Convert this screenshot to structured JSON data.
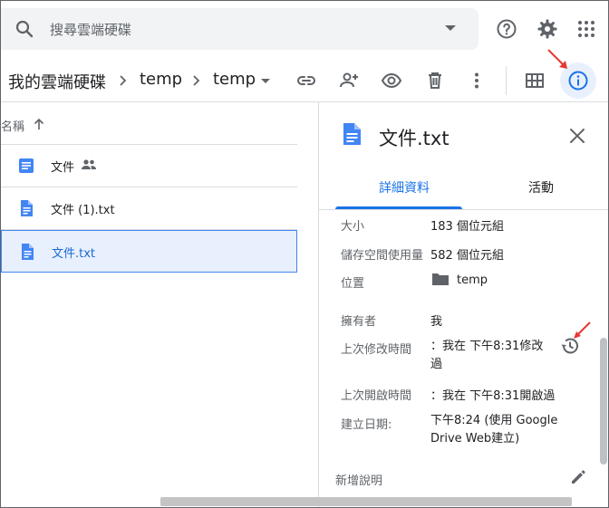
{
  "search": {
    "placeholder": "搜尋雲端硬碟"
  },
  "breadcrumb": {
    "root": "我的雲端硬碟",
    "level1": "temp",
    "level2": "temp"
  },
  "list": {
    "header": "名稱",
    "files": [
      {
        "name": "文件",
        "type": "doc",
        "shared": true
      },
      {
        "name": "文件 (1).txt",
        "type": "file",
        "shared": false
      },
      {
        "name": "文件.txt",
        "type": "file",
        "shared": false,
        "selected": true
      }
    ]
  },
  "panel": {
    "title": "文件.txt",
    "tabs": {
      "details": "詳細資料",
      "activity": "活動"
    },
    "details": {
      "size_label": "大小",
      "size_value": "183 個位元組",
      "storage_label": "儲存空間使用量",
      "storage_value": "582 個位元組",
      "location_label": "位置",
      "location_value": "temp",
      "owner_label": "擁有者",
      "owner_value": "我",
      "modified_label": "上次修改時間",
      "modified_value": "：我在 下午8:31修改過",
      "opened_label": "上次開啟時間",
      "opened_value": "：我在 下午8:31開啟過",
      "created_label": "建立日期:",
      "created_value": "下午8:24 (使用 Google Drive Web建立)",
      "description_label": "新增說明"
    }
  },
  "colors": {
    "accent": "#1a73e8",
    "doc_blue": "#4285f4",
    "annotation_red": "#e53935"
  }
}
